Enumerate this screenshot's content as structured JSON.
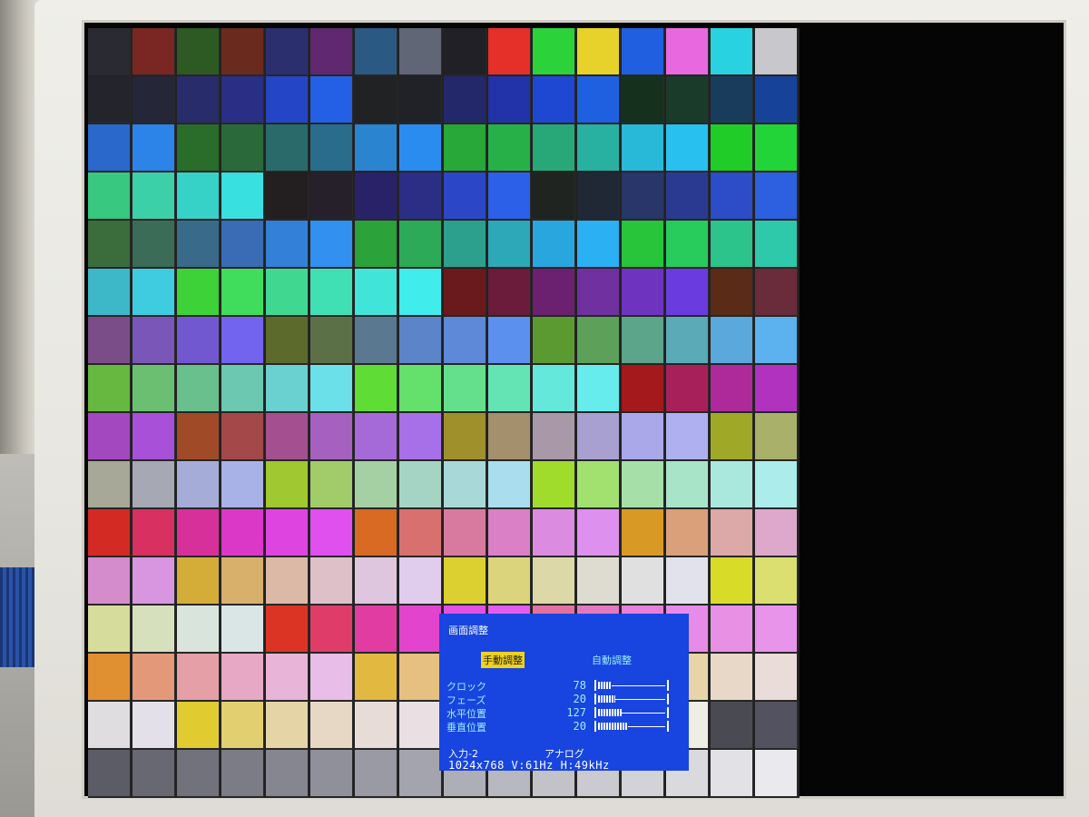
{
  "colors": {
    "osd_background": "#1844e0",
    "osd_highlight": "#f0d21c",
    "osd_text_cyan": "#9cf0ff",
    "screen_black": "#050505",
    "bezel": "#eceae4"
  },
  "color_grid": [
    [
      "#2a2a33",
      "#7a2622",
      "#2c5a22",
      "#6b2a1e",
      "#2b2f6e",
      "#5f2870",
      "#2a5a84",
      "#616676",
      "#202026",
      "#e5302a",
      "#2cd23a",
      "#e6d22a",
      "#2060e0",
      "#e868e0",
      "#28d2e0",
      "#c8c8cc"
    ],
    [
      "#23242c",
      "#252638",
      "#282c6a",
      "#2a2e84",
      "#2446c6",
      "#2460e6",
      "#202224",
      "#202228",
      "#23286a",
      "#2232a8",
      "#1e48d2",
      "#1e60e0",
      "#16301e",
      "#1a3a2a",
      "#1a3c5c",
      "#16429a"
    ],
    [
      "#2a68cc",
      "#2c84e8",
      "#2a6c2a",
      "#2a6a3a",
      "#2a6a6a",
      "#2a6c8c",
      "#2a84d0",
      "#2a8cee",
      "#28a838",
      "#28b048",
      "#28a878",
      "#28b0a0",
      "#28b8d8",
      "#28c0ee",
      "#20cc28",
      "#22d438"
    ],
    [
      "#38c880",
      "#3cd0a8",
      "#36d2c8",
      "#38e0e0",
      "#231e20",
      "#25202a",
      "#2a2268",
      "#2c2e86",
      "#2c46c8",
      "#2c60e8",
      "#202420",
      "#202836",
      "#28366a",
      "#2a3a90",
      "#2c4cc8",
      "#2c60e0"
    ],
    [
      "#3a6c3c",
      "#3a6c58",
      "#3a6a8a",
      "#3a6cb6",
      "#3280d8",
      "#3290f0",
      "#2ca23a",
      "#2caa58",
      "#2ca08c",
      "#2ca8b8",
      "#2aa6de",
      "#2cb0f4",
      "#28c43a",
      "#28cc5c",
      "#2cc48a",
      "#2ec8aa"
    ],
    [
      "#3cb8c8",
      "#40cce0",
      "#3cd238",
      "#40dc5c",
      "#40d890",
      "#40e0b4",
      "#40e4d8",
      "#40ecec",
      "#6a1a1c",
      "#6a1c3a",
      "#6c2070",
      "#7030a0",
      "#6e34c0",
      "#6a3ce0",
      "#5a2c18",
      "#6a2c3a"
    ],
    [
      "#7a4c88",
      "#7a56b8",
      "#7258d0",
      "#7264ee",
      "#5c6a2c",
      "#5c7048",
      "#5a7890",
      "#5c84c8",
      "#5e88d8",
      "#5c90ee",
      "#5a9a30",
      "#5ca05a",
      "#5ca48a",
      "#5aaab8",
      "#5aa8dc",
      "#5cb2ee"
    ],
    [
      "#66b840",
      "#6ac070",
      "#6ac08c",
      "#6cc8b0",
      "#6ad0d0",
      "#6ce0e8",
      "#60dc36",
      "#64e06c",
      "#64e08c",
      "#64e4b4",
      "#64e8dc",
      "#66ecec",
      "#a41a1c",
      "#a8205a",
      "#ae2a9a",
      "#b232c0"
    ],
    [
      "#a448c0",
      "#a850d8",
      "#a04a28",
      "#a4484a",
      "#a45090",
      "#a660c0",
      "#a66ad8",
      "#a870e8",
      "#a0902c",
      "#a4906c",
      "#a898a8",
      "#a8a0d0",
      "#aaa8e8",
      "#aeb0f0",
      "#a0a828",
      "#a8b06a"
    ],
    [
      "#a8a898",
      "#a6a8b4",
      "#a6acd8",
      "#a8b2e6",
      "#a0c830",
      "#a2cc6a",
      "#a4d0a4",
      "#a6d4c4",
      "#a8d8d8",
      "#aadeee",
      "#a0dc2c",
      "#a2e070",
      "#a6e0a8",
      "#a8e4c8",
      "#aae8de",
      "#acecea"
    ],
    [
      "#d42a24",
      "#d83060",
      "#d8309a",
      "#dc38c8",
      "#de44e0",
      "#e050ee",
      "#d86a24",
      "#d87070",
      "#d87aa0",
      "#da80c6",
      "#dc8ce0",
      "#de90ee",
      "#d89a24",
      "#daa07a",
      "#dca8a8",
      "#dea8cc"
    ],
    [
      "#d48ccc",
      "#d896e0",
      "#d4ac38",
      "#d8b06c",
      "#dcb8a6",
      "#dec0c8",
      "#dec6de",
      "#e0ccec",
      "#dcd030",
      "#dcd47c",
      "#dcd8a8",
      "#dedcd0",
      "#e0e0e0",
      "#e2e2ec",
      "#d8dc28",
      "#dadf70"
    ],
    [
      "#d6dc9c",
      "#d6e0bc",
      "#d8e4dc",
      "#dae6e6",
      "#dc3424",
      "#e03c6a",
      "#e03ca2",
      "#e244ce",
      "#e450e0",
      "#e45cee",
      "#e470a0",
      "#e478c0",
      "#e680d8",
      "#e68ce8",
      "#e890e4",
      "#e894ea"
    ],
    [
      "#e09030",
      "#e4987a",
      "#e4a0a6",
      "#e6a8c4",
      "#e8b4d8",
      "#e8bee8",
      "#e2b840",
      "#e6c080",
      "#e8c4a8",
      "#e8cad0",
      "#eacce0",
      "#eaceea",
      "#e6d040",
      "#e8d4a8",
      "#e8d8c8",
      "#eadcd8"
    ],
    [
      "#e0dde0",
      "#e4e0ea",
      "#e0cc30",
      "#e2d070",
      "#e4d4a6",
      "#e6d8c4",
      "#e8dcd8",
      "#eae0e4",
      "#e8e43c",
      "#e8e880",
      "#eaeab0",
      "#ececd0",
      "#eceddd",
      "#eeeee4",
      "#4a4a52",
      "#525260"
    ],
    [
      "#5c5c66",
      "#686872",
      "#72727c",
      "#7c7c86",
      "#868690",
      "#90909a",
      "#9a9aa4",
      "#a4a4ae",
      "#aeaeb6",
      "#b8b8c0",
      "#c2c2c8",
      "#cacad0",
      "#d2d2d8",
      "#dadade",
      "#e2e2e6",
      "#eaeaee"
    ]
  ],
  "osd": {
    "title": "画面調整",
    "tab_manual": "手動調整",
    "tab_auto": "自動調整",
    "settings": [
      {
        "label": "クロック",
        "value": "78",
        "level": 0.2
      },
      {
        "label": "フェーズ",
        "value": "20",
        "level": 0.25
      },
      {
        "label": "水平位置",
        "value": "127",
        "level": 0.35
      },
      {
        "label": "垂直位置",
        "value": "20",
        "level": 0.45
      }
    ],
    "input_label": "入力-2",
    "input_type": "アナログ",
    "signal_info": "1024x768  V:61Hz  H:49kHz"
  }
}
